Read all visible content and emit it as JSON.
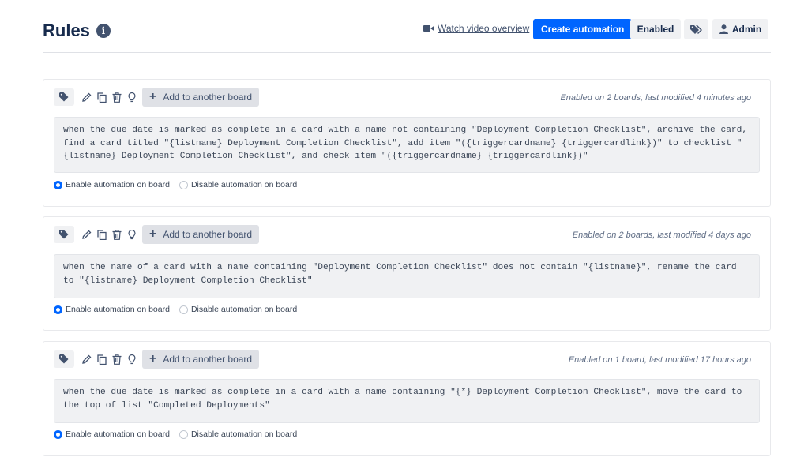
{
  "header": {
    "title": "Rules",
    "info_icon": "info-icon",
    "video_link": "Watch video overview",
    "create_button": "Create automation",
    "enabled_button": "Enabled",
    "admin_button": "Admin"
  },
  "colors": {
    "primary": "#0065ff",
    "button_gray": "#f0f1f3",
    "text": "#172b4d",
    "rule_bg": "#f0f1f3"
  },
  "rules": [
    {
      "add_board_label": "Add to another board",
      "meta": "Enabled on 2 boards, last modified 4 minutes ago",
      "text": "when the due date is marked as complete in a card with a name not containing \"Deployment Completion Checklist\", archive the card, find a card titled \"{listname} Deployment Completion Checklist\", add item \"({triggercardname} {triggercardlink})\" to checklist \"{listname} Deployment Completion Checklist\", and check item \"({triggercardname} {triggercardlink})\"",
      "enable_label": "Enable automation on board",
      "disable_label": "Disable automation on board"
    },
    {
      "add_board_label": "Add to another board",
      "meta": "Enabled on 2 boards, last modified 4 days ago",
      "text": "when the name of a card with a name containing \"Deployment Completion Checklist\" does not contain \"{listname}\", rename the card to \"{listname} Deployment Completion Checklist\"",
      "enable_label": "Enable automation on board",
      "disable_label": "Disable automation on board"
    },
    {
      "add_board_label": "Add to another board",
      "meta": "Enabled on 1 board, last modified 17 hours ago",
      "text": "when the due date is marked as complete in a card with a name containing \"{*} Deployment Completion Checklist\", move the card to the top of list \"Completed Deployments\"",
      "enable_label": "Enable automation on board",
      "disable_label": "Disable automation on board"
    }
  ]
}
